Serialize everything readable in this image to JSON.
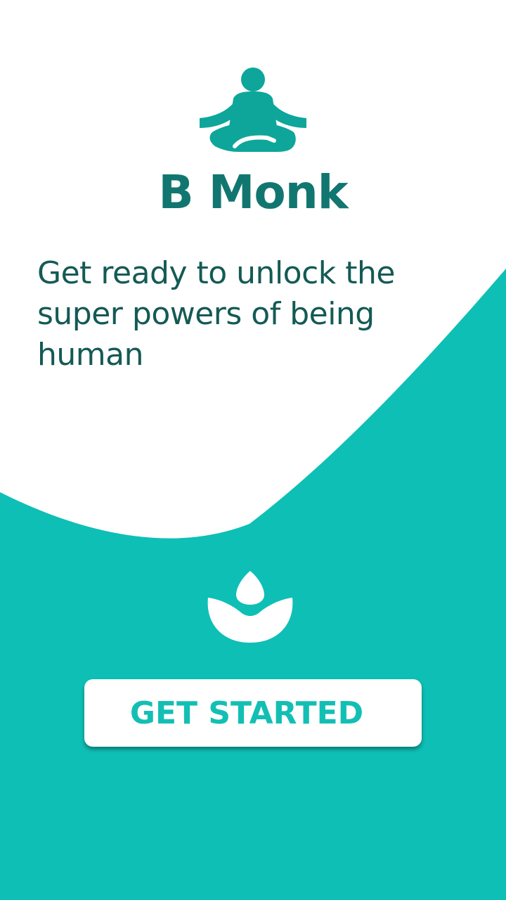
{
  "app": {
    "title": "B Monk",
    "tagline": "Get ready to unlock the super powers of being human"
  },
  "cta": {
    "label": "GET STARTED"
  },
  "icons": {
    "logo": "meditating-person-icon",
    "emblem": "lotus-icon"
  },
  "colors": {
    "teal": "#0ebfb5",
    "aqua_wave": "#22f4e8",
    "title_text": "#127670",
    "tagline_text": "#145a55",
    "logo_fill": "#0ea69b",
    "button_text": "#13bfb4",
    "background": "#ffffff"
  }
}
